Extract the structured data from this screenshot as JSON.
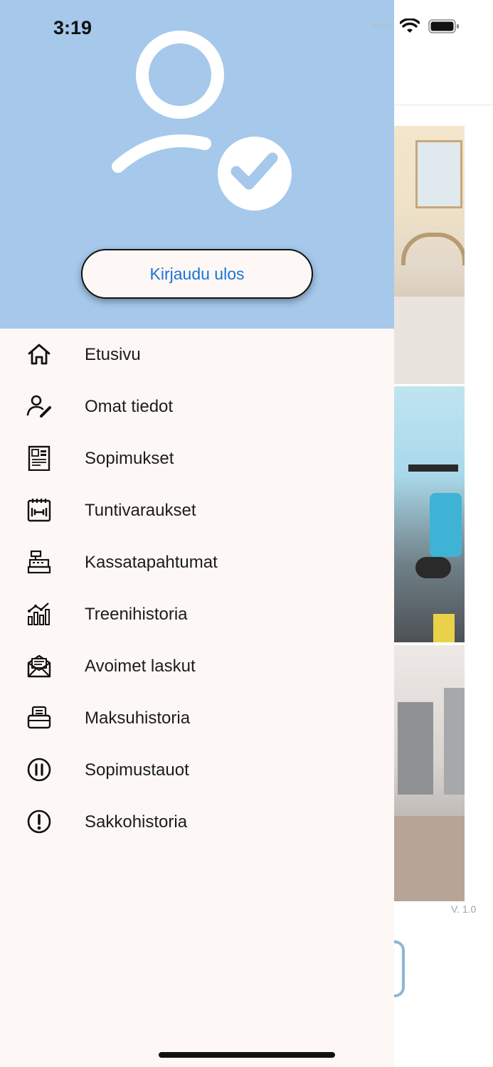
{
  "status_bar": {
    "time": "3:19"
  },
  "drawer": {
    "logout_label": "Kirjaudu ulos",
    "menu": [
      {
        "label": "Etusivu",
        "icon": "home-icon"
      },
      {
        "label": "Omat tiedot",
        "icon": "user-edit-icon"
      },
      {
        "label": "Sopimukset",
        "icon": "contract-icon"
      },
      {
        "label": "Tuntivaraukset",
        "icon": "calendar-dumbbell-icon"
      },
      {
        "label": "Kassatapahtumat",
        "icon": "cash-register-icon"
      },
      {
        "label": "Treenihistoria",
        "icon": "chart-icon"
      },
      {
        "label": "Avoimet laskut",
        "icon": "envelope-icon"
      },
      {
        "label": "Maksuhistoria",
        "icon": "receipt-printer-icon"
      },
      {
        "label": "Sopimustauot",
        "icon": "pause-icon"
      },
      {
        "label": "Sakkohistoria",
        "icon": "exclamation-icon"
      }
    ]
  },
  "background": {
    "version": "V. 1.0"
  },
  "colors": {
    "header": "#a5c8eb",
    "drawer": "#fdf8f6",
    "accent": "#1a73d9"
  }
}
